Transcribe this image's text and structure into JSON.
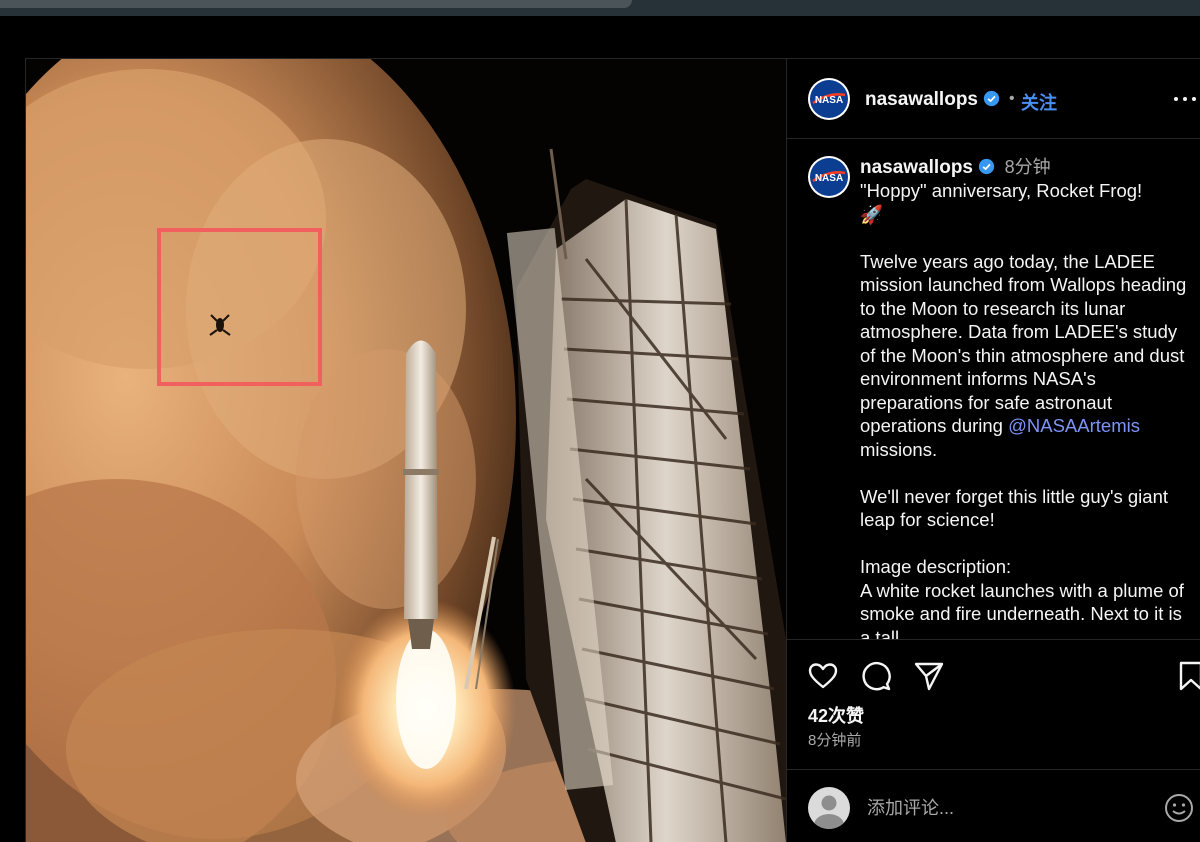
{
  "colors": {
    "accent": "#4a8ff2",
    "mention": "#7d93f5",
    "highlight_box": "#f25f5f",
    "verified": "#3897f0"
  },
  "media": {
    "icon": "rocket-launch-photo"
  },
  "header": {
    "username": "nasawallops",
    "separator": "•",
    "follow_label": "关注"
  },
  "caption": {
    "username": "nasawallops",
    "time": "8分钟",
    "line1": "\"Hoppy\" anniversary, Rocket Frog!",
    "emoji": "🚀",
    "para1": "Twelve years ago today, the LADEE mission launched from Wallops heading to the Moon to research its lunar atmosphere. Data from LADEE's study of the Moon's thin atmosphere and dust environment informs NASA's preparations for safe astronaut operations during ",
    "mention": "@NASAArtemis",
    "para1_end": " missions.",
    "para2": "We'll never forget this little guy's giant leap for science!",
    "para3_title": "Image description:",
    "para3": "A white rocket launches with a plume of smoke and fire underneath. Next to it is a tall"
  },
  "actions": {
    "like_icon": "heart-icon",
    "comment_icon": "comment-icon",
    "share_icon": "share-icon",
    "save_icon": "bookmark-icon",
    "likes": "42次赞",
    "ago": "8分钟前"
  },
  "comment": {
    "placeholder": "添加评论...",
    "emoji_icon": "smiley-icon"
  }
}
